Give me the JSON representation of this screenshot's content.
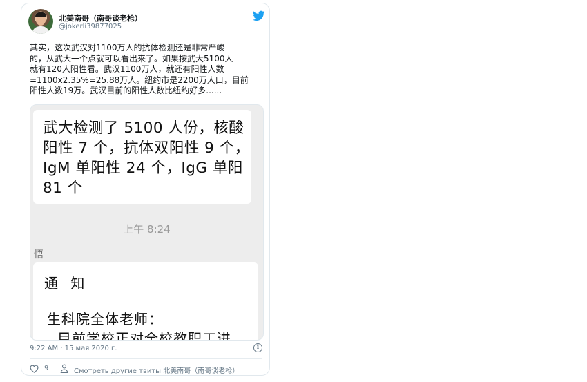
{
  "tweet": {
    "author_name": "北美南哥（南哥谈老枪）",
    "author_handle": "@jokerli39877025",
    "text": "其实，这次武汉对1100万人的抗体检测还是非常严峻\n的，从武大一个点就可以看出来了。如果按武大5100人\n就有120人阳性看。武汉1100万人，就还有阳性人数\n=1100x2.35%=25.88万人。纽约市是2200万人口，目前\n阳性人数19万。武汉目前的阳性人数比纽约好多......",
    "timestamp": "9:22 AM · 15 мая 2020 г.",
    "like_count": "9",
    "more_tweets_label": "Смотреть другие твиты 北美南哥（南哥谈老枪）"
  },
  "media": {
    "message_text": "武大检测了 5100 人份，核酸\n阳性 7 个，抗体双阳性 9 个，\nIgM 单阳性 24 个，IgG 单阳\n81 个",
    "chat_time": "上午 8:24",
    "sender_name": "悟",
    "notice_title": "通 知",
    "notice_line1": "生科院全体老师：",
    "notice_line2": "目前学校正对全校教职工进"
  },
  "icons": {
    "brand": "twitter-bird-icon",
    "info": "info-icon",
    "like": "heart-icon",
    "profile": "user-icon"
  },
  "colors": {
    "twitter_blue": "#1da1f2",
    "secondary_text": "#657786",
    "chat_background": "#ededed"
  }
}
